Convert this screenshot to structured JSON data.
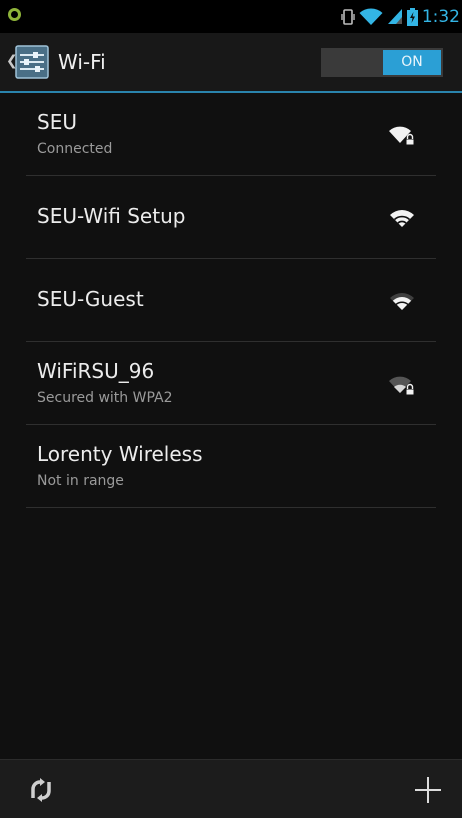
{
  "status_bar": {
    "time": "1:32",
    "icons": [
      "notification-icon",
      "vibrate-icon",
      "wifi-signal-icon",
      "cell-signal-icon",
      "battery-icon"
    ]
  },
  "action_bar": {
    "title": "Wi-Fi",
    "toggle_label": "ON",
    "app_icon": "wifi-settings-icon"
  },
  "networks": [
    {
      "name": "SEU",
      "status": "Connected",
      "secured": true,
      "signal_level": 4
    },
    {
      "name": "SEU-Wifi Setup",
      "status": "",
      "secured": false,
      "signal_level": 4
    },
    {
      "name": "SEU-Guest",
      "status": "",
      "secured": false,
      "signal_level": 3
    },
    {
      "name": "WiFiRSU_96",
      "status": "Secured with WPA2",
      "secured": true,
      "signal_level": 2
    },
    {
      "name": "Lorenty Wireless",
      "status": "Not in range",
      "secured": false,
      "signal_level": 0
    }
  ],
  "bottom_bar": {
    "left_action": "scan-icon",
    "right_action": "add-network-icon"
  },
  "colors": {
    "accent": "#33b5e5",
    "toggle_on": "#2b9fd5",
    "background": "#101010"
  }
}
